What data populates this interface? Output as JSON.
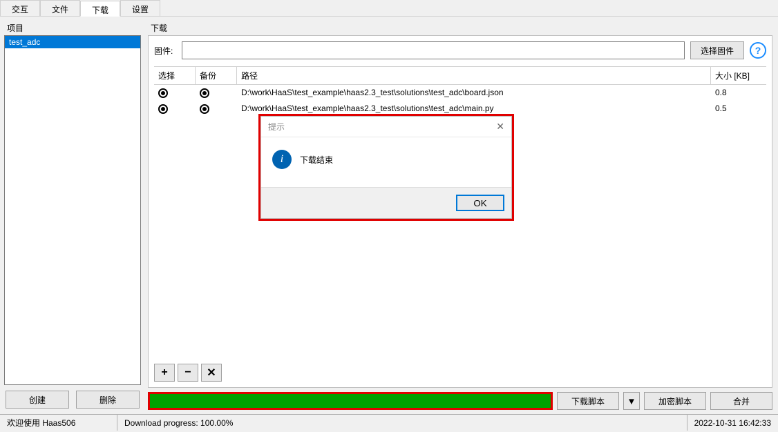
{
  "tabs": {
    "interact": "交互",
    "file": "文件",
    "download": "下载",
    "settings": "设置",
    "active": "download"
  },
  "left": {
    "label": "项目",
    "selected_project": "test_adc",
    "btn_create": "创建",
    "btn_delete": "删除"
  },
  "right": {
    "label": "下载",
    "firmware_label": "固件:",
    "firmware_value": "",
    "btn_select_firmware": "选择固件",
    "help_symbol": "?",
    "table": {
      "col_select": "选择",
      "col_backup": "备份",
      "col_path": "路径",
      "col_size": "大小 [KB]",
      "rows": [
        {
          "path": "D:\\work\\HaaS\\test_example\\haas2.3_test\\solutions\\test_adc\\board.json",
          "size": "0.8"
        },
        {
          "path": "D:\\work\\HaaS\\test_example\\haas2.3_test\\solutions\\test_adc\\main.py",
          "size": "0.5"
        }
      ]
    },
    "toolbar": {
      "add": "+",
      "remove": "−",
      "clear": "✕"
    },
    "actions": {
      "btn_download_script": "下载脚本",
      "dropdown": "▼",
      "btn_encrypt_script": "加密脚本",
      "btn_merge": "合并"
    }
  },
  "dialog": {
    "title": "提示",
    "info_symbol": "i",
    "message": "下载结束",
    "btn_ok": "OK"
  },
  "status": {
    "welcome": "欢迎使用 Haas506",
    "progress": "Download progress: 100.00%",
    "datetime": "2022-10-31 16:42:33"
  }
}
